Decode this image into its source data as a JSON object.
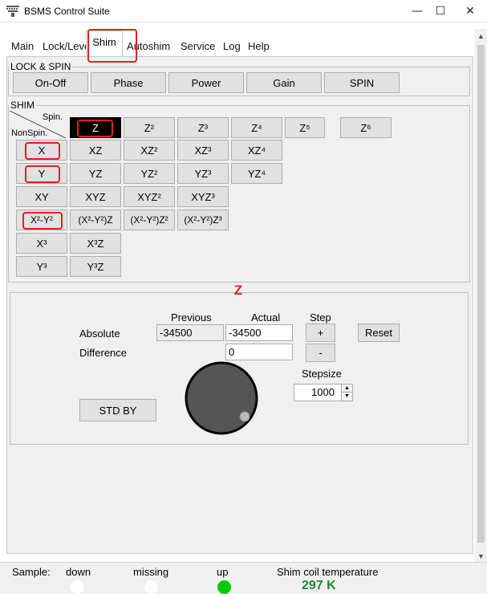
{
  "window": {
    "title": "BSMS Control Suite",
    "minimize": "—",
    "maximize": "☐",
    "close": "✕"
  },
  "menu": {
    "tabs": [
      "Main",
      "Lock/Level",
      "Shim",
      "Autoshim",
      "Service",
      "Log",
      "Help"
    ],
    "active": "Shim"
  },
  "lock_spin": {
    "legend": "LOCK & SPIN",
    "buttons": [
      "On-Off",
      "Phase",
      "Power",
      "Gain",
      "SPIN"
    ]
  },
  "shim": {
    "legend": "SHIM",
    "corner_spin": "Spin.",
    "corner_nonspin": "NonSpin.",
    "spin_row": [
      "Z",
      "Z²",
      "Z³",
      "Z⁴",
      "Z⁵",
      "Z⁶"
    ],
    "rows": [
      [
        "X",
        "XZ",
        "XZ²",
        "XZ³",
        "XZ⁴"
      ],
      [
        "Y",
        "YZ",
        "YZ²",
        "YZ³",
        "YZ⁴"
      ],
      [
        "XY",
        "XYZ",
        "XYZ²",
        "XYZ³"
      ],
      [
        "X²-Y²",
        "(X²-Y²)Z",
        "(X²-Y²)Z²",
        "(X²-Y²)Z³"
      ],
      [
        "X³",
        "X³Z"
      ],
      [
        "Y³",
        "Y³Z"
      ]
    ],
    "selected": "Z"
  },
  "control": {
    "selected_label": "Z",
    "col_previous": "Previous",
    "col_actual": "Actual",
    "col_step": "Step",
    "row_absolute": "Absolute",
    "row_difference": "Difference",
    "absolute_previous": "-34500",
    "absolute_actual": "-34500",
    "difference_actual": "0",
    "plus": "+",
    "minus": "-",
    "reset": "Reset",
    "stepsize_label": "Stepsize",
    "stepsize_value": "1000",
    "stdby": "STD BY"
  },
  "status": {
    "sample_label": "Sample:",
    "down": "down",
    "missing": "missing",
    "up": "up",
    "temp_label": "Shim coil temperature",
    "temp_value": "297 K"
  },
  "colors": {
    "highlight": "#e0211f",
    "led_on": "#00cc00",
    "led_off": "#ffffff",
    "temperature": "#1f8a2c"
  }
}
